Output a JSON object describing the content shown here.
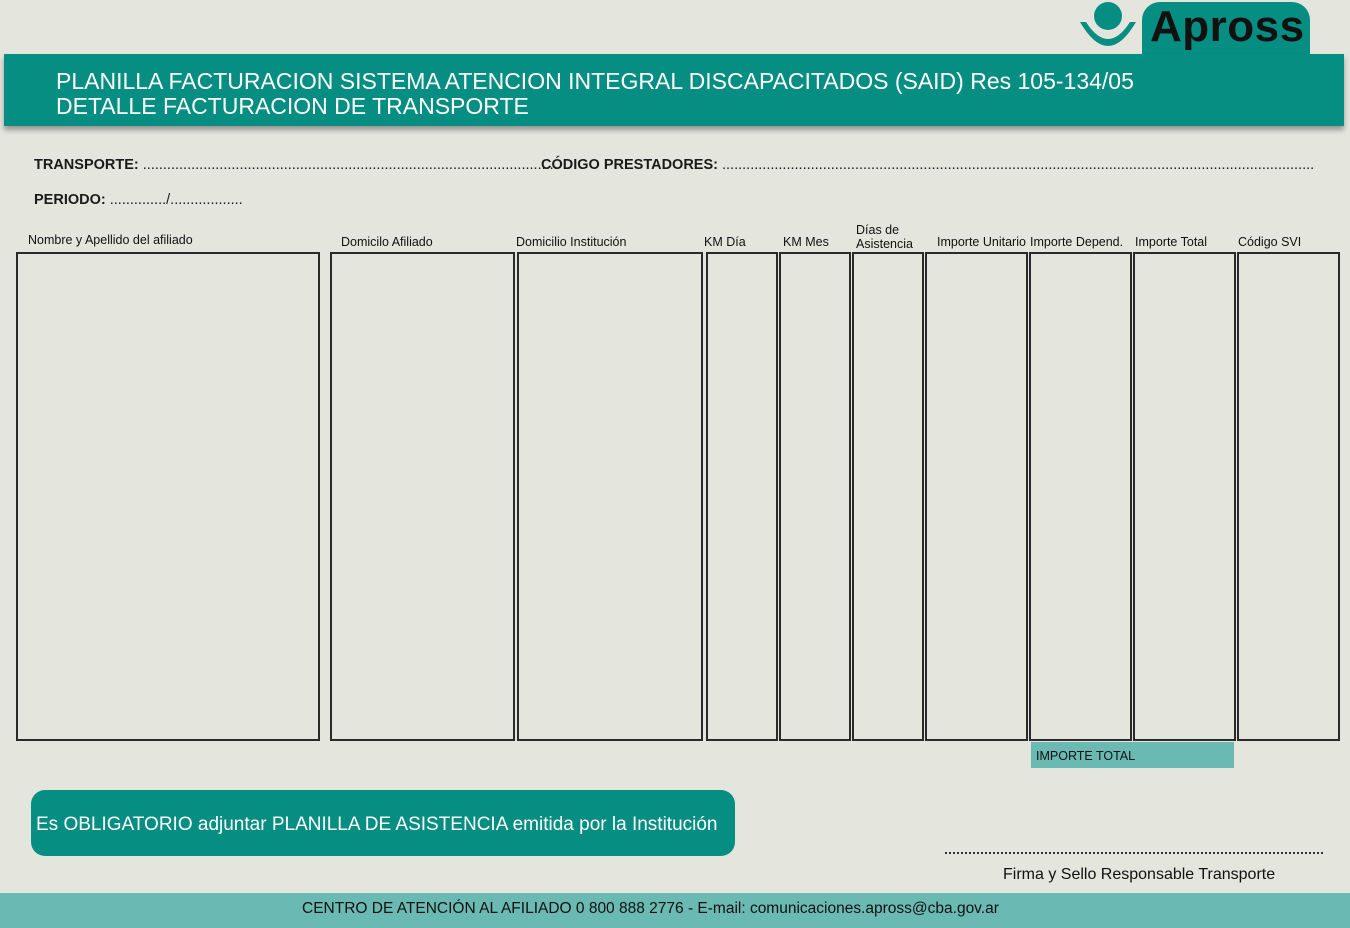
{
  "brand": {
    "logo_text": "Apross",
    "accent": "#068e82",
    "light_accent": "#6ab9b3"
  },
  "header": {
    "title_line1": "PLANILLA FACTURACION SISTEMA ATENCION INTEGRAL DISCAPACITADOS (SAID) Res 105-134/05",
    "title_line2": "DETALLE FACTURACION DE TRANSPORTE"
  },
  "fields": {
    "transporte_label": "TRANSPORTE:",
    "codigo_label": "CÓDIGO PRESTADORES:",
    "periodo_label": "PERIODO:",
    "periodo_dots": "............../.................."
  },
  "columns": [
    {
      "label": "Nombre y Apellido del afiliado"
    },
    {
      "label": "Domicilo Afiliado"
    },
    {
      "label": "Domicilio Institución"
    },
    {
      "label": "KM Día"
    },
    {
      "label": "KM Mes"
    },
    {
      "label": "Días de\nAsistencia"
    },
    {
      "label": "Importe Unitario"
    },
    {
      "label": "Importe Depend."
    },
    {
      "label": "Importe Total"
    },
    {
      "label": "Código SVI"
    }
  ],
  "importe_total_label": "IMPORTE TOTAL",
  "notice": "Es OBLIGATORIO adjuntar PLANILLA DE ASISTENCIA emitida por la Institución",
  "signature_label": "Firma y Sello Responsable Transporte",
  "footer": "CENTRO DE ATENCIÓN AL AFILIADO 0 800 888 2776 - E-mail: comunicaciones.apross@cba.gov.ar"
}
